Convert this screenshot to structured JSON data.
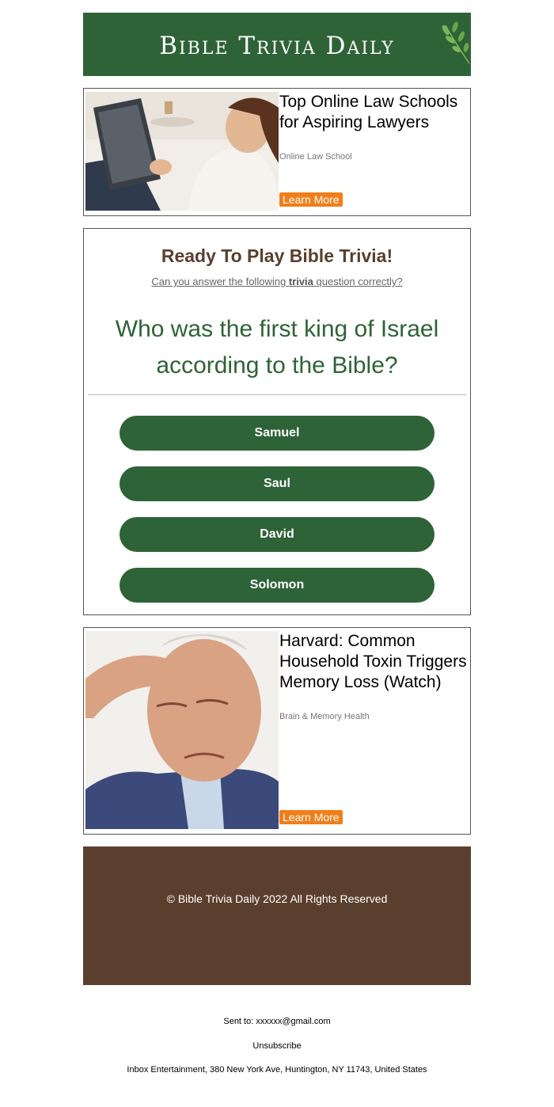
{
  "header": {
    "logo_text": "Bible Trivia Daily",
    "leaf_icon": "olive-branch-icon",
    "bg_color": "#2e6337"
  },
  "ads": [
    {
      "title": "Top Online Law Schools for Aspiring Lawyers",
      "source": "Online Law School",
      "cta": "Learn More"
    },
    {
      "title": "Harvard: Common Household Toxin Triggers Memory Loss (Watch)",
      "source": "Brain & Memory Health",
      "cta": "Learn More"
    }
  ],
  "quiz": {
    "title": "Ready To Play Bible Trivia!",
    "subtitle_pre": "Can you answer the following",
    "subtitle_bold": "trivia",
    "subtitle_post": "question correctly?",
    "question": "Who was the first king of Israel according to the Bible?",
    "answers": [
      "Samuel",
      "Saul",
      "David",
      "Solomon"
    ]
  },
  "footer": {
    "copyright": "© Bible Trivia Daily 2022 All Rights Reserved",
    "bg_color": "#5a3f2f"
  },
  "meta": {
    "sent_to": "Sent to: xxxxxx@gmail.com",
    "unsubscribe": "Unsubscribe",
    "address": "Inbox Entertainment, 380 New York Ave, Huntington, NY 11743, United States"
  },
  "colors": {
    "accent_green": "#2e6337",
    "cta_orange": "#f07f1a",
    "brown": "#5a3f2f"
  }
}
